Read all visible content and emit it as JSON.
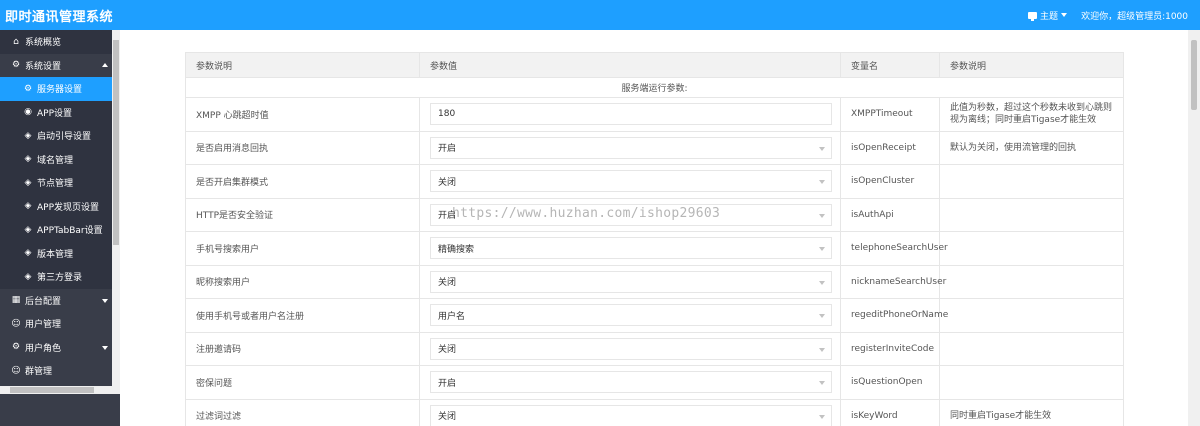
{
  "header": {
    "title": "即时通讯管理系统",
    "theme_label": "主题",
    "welcome": "欢迎你，超级管理员:1000"
  },
  "sidebar": {
    "items": [
      {
        "label": "系统概览",
        "icon": "home-icon"
      },
      {
        "label": "系统设置",
        "icon": "gear-icon"
      },
      {
        "label": "服务器设置",
        "icon": "gear-icon"
      },
      {
        "label": "APP设置",
        "icon": "globe-icon"
      },
      {
        "label": "启动引导设置",
        "icon": "layers-icon"
      },
      {
        "label": "域名管理",
        "icon": "layers-icon"
      },
      {
        "label": "节点管理",
        "icon": "layers-icon"
      },
      {
        "label": "APP发现页设置",
        "icon": "layers-icon"
      },
      {
        "label": "APPTabBar设置",
        "icon": "layers-icon"
      },
      {
        "label": "版本管理",
        "icon": "layers-icon"
      },
      {
        "label": "第三方登录",
        "icon": "layers-icon"
      },
      {
        "label": "后台配置",
        "icon": "calendar-icon"
      },
      {
        "label": "用户管理",
        "icon": "user-icon"
      },
      {
        "label": "用户角色",
        "icon": "gear-icon"
      },
      {
        "label": "群管理",
        "icon": "group-icon"
      }
    ]
  },
  "table": {
    "headers": [
      "参数说明",
      "参数值",
      "变量名",
      "参数说明"
    ],
    "section_title": "服务端运行参数:",
    "rows": [
      {
        "label": "XMPP 心跳超时值",
        "value": "180",
        "type": "input",
        "var": "XMPPTimeout",
        "note": "此值为秒数，超过这个秒数未收到心跳则视为离线；同时重启Tigase才能生效"
      },
      {
        "label": "是否启用消息回执",
        "value": "开启",
        "type": "select",
        "var": "isOpenReceipt",
        "note": "默认为关闭，使用流管理的回执"
      },
      {
        "label": "是否开启集群模式",
        "value": "关闭",
        "type": "select",
        "var": "isOpenCluster",
        "note": ""
      },
      {
        "label": "HTTP是否安全验证",
        "value": "开启",
        "type": "select",
        "var": "isAuthApi",
        "note": ""
      },
      {
        "label": "手机号搜索用户",
        "value": "精确搜索",
        "type": "select",
        "var": "telephoneSearchUser",
        "note": ""
      },
      {
        "label": "昵称搜索用户",
        "value": "关闭",
        "type": "select",
        "var": "nicknameSearchUser",
        "note": ""
      },
      {
        "label": "使用手机号或者用户名注册",
        "value": "用户名",
        "type": "select",
        "var": "regeditPhoneOrName",
        "note": ""
      },
      {
        "label": "注册邀请码",
        "value": "关闭",
        "type": "select",
        "var": "registerInviteCode",
        "note": ""
      },
      {
        "label": "密保问题",
        "value": "开启",
        "type": "select",
        "var": "isQuestionOpen",
        "note": ""
      },
      {
        "label": "过滤词过滤",
        "value": "关闭",
        "type": "select",
        "var": "isKeyWord",
        "note": "同时重启Tigase才能生效"
      }
    ]
  },
  "watermark": "https://www.huzhan.com/ishop29603"
}
